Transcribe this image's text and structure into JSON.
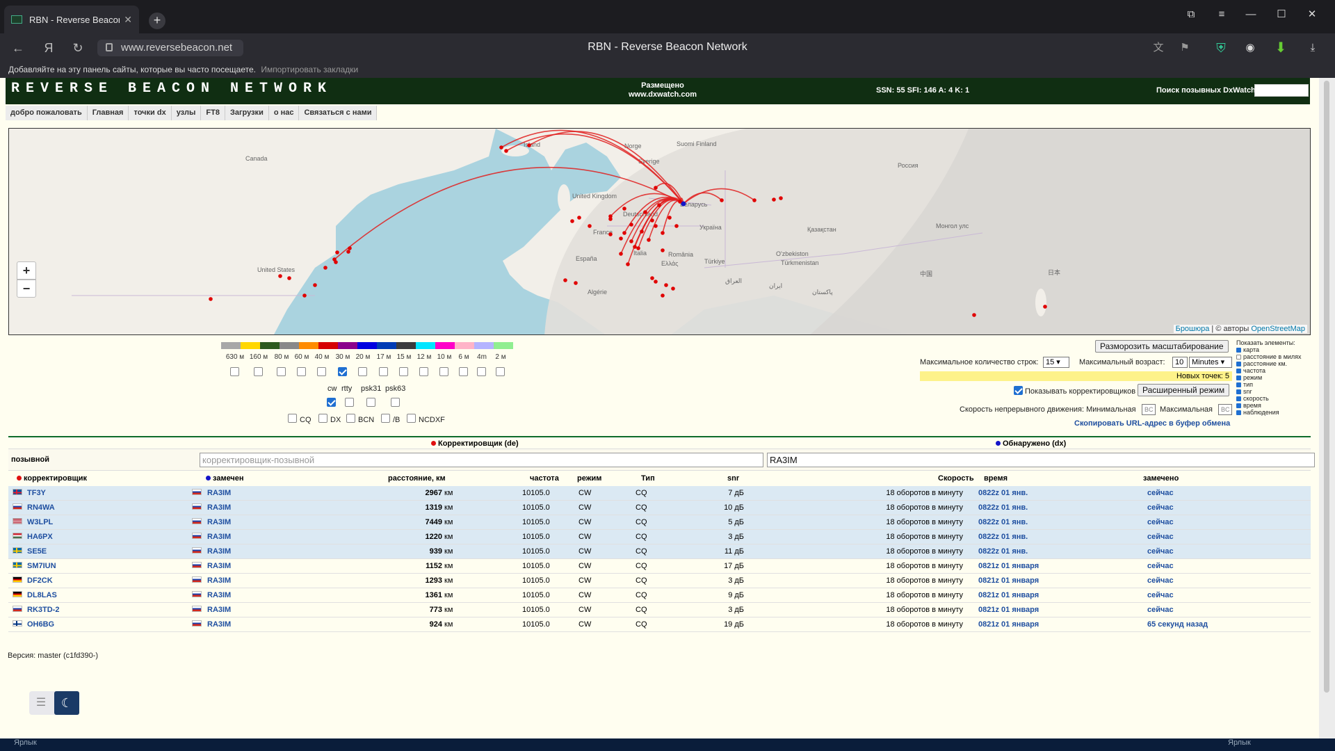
{
  "browser": {
    "tab_title": "RBN - Reverse Beacon N",
    "url": "www.reversebeacon.net",
    "window_title": "RBN - Reverse Beacon Network",
    "bookmarks_hint": "Добавляйте на эту панель сайты, которые вы часто посещаете.",
    "import_bookmarks": "Импортировать закладки"
  },
  "header": {
    "logo": "REVERSE BEACON NETWORK",
    "hosted_line1": "Размещено",
    "hosted_line2": "www.dxwatch.com",
    "solar": "SSN: 55 SFI: 146 A: 4 K: 1",
    "dxwatch_search_label": "Поиск позывных DxWatch:"
  },
  "menu": [
    "добро пожаловать",
    "Главная",
    "точки dx",
    "узлы",
    "FT8",
    "Загрузки",
    "о нас",
    "Связаться с нами"
  ],
  "map": {
    "labels": [
      "Island",
      "Norge",
      "Suomi Finland",
      "Sverige",
      "Canada",
      "Россия",
      "United Kingdom",
      "Deutschland",
      "Беларусь",
      "France",
      "Україна",
      "Қазақстан",
      "Монгол улс",
      "España",
      "Italia",
      "România",
      "O'zbekiston",
      "Türkmenistan",
      "United States",
      "Türkiye",
      "Ελλάς",
      "中国",
      "العراق",
      "ایران",
      "پاکستان",
      "Algérie",
      "日本"
    ],
    "attribution_browser": "Брошюра",
    "attribution_sep": "| © авторы",
    "attribution_osm": "OpenStreetMap",
    "zoom_in": "+",
    "zoom_out": "−"
  },
  "bands": {
    "colors": [
      "#a8a8a8",
      "#ffd700",
      "#2d5a1e",
      "#898989",
      "#ff8c00",
      "#d60000",
      "#8b008b",
      "#0000e0",
      "#003cb4",
      "#3c3c3c",
      "#00e6ff",
      "#ff00c8",
      "#ffb4c8",
      "#b4b4ff",
      "#90ee90"
    ],
    "labels": [
      "630 м",
      "160 м",
      "80 м",
      "60 м",
      "40 м",
      "30 м",
      "20 м",
      "17 м",
      "15 м",
      "12 м",
      "10 м",
      "6 м",
      "4m",
      "2 м"
    ],
    "checked": [
      false,
      false,
      false,
      false,
      false,
      true,
      false,
      false,
      false,
      false,
      false,
      false,
      false,
      false
    ]
  },
  "modes": {
    "labels": [
      "cw",
      "rtty",
      "psk31",
      "psk63"
    ],
    "checked": [
      true,
      false,
      false,
      false
    ]
  },
  "types": {
    "labels": [
      "CQ",
      "DX",
      "BCN",
      "/B",
      "NCDXF"
    ],
    "checked": [
      false,
      false,
      false,
      false,
      false
    ]
  },
  "controls": {
    "unfreeze_zoom": "Разморозить масштабирование",
    "max_rows_label": "Максимальное количество строк:",
    "max_rows_value": "15",
    "max_age_label": "Максимальный возраст:",
    "max_age_value": "10",
    "max_age_unit": "Minutes",
    "new_points": "Новых точек: 5",
    "show_skimmers": "Показывать корректировщиков",
    "show_skimmers_checked": true,
    "advanced_mode": "Расширенный режим",
    "scroll_speed": "Скорость непрерывного движения: Минимальная",
    "scroll_max": "Максимальная",
    "bc_min": "BC",
    "bc_max": "BC",
    "copy_url": "Скопировать URL-адрес в буфер обмена"
  },
  "show_elements": {
    "title": "Показать элементы:",
    "items": [
      {
        "label": "карта",
        "on": true
      },
      {
        "label": "расстояние в милях",
        "on": false
      },
      {
        "label": "расстояние км.",
        "on": true
      },
      {
        "label": "частота",
        "on": true
      },
      {
        "label": "режим",
        "on": true
      },
      {
        "label": "тип",
        "on": true
      },
      {
        "label": "snr",
        "on": true
      },
      {
        "label": "скорость",
        "on": true
      },
      {
        "label": "время",
        "on": true
      },
      {
        "label": "наблюдения",
        "on": true
      }
    ]
  },
  "table": {
    "spotter_header": "Корректировщик (de)",
    "spotted_header": "Обнаружено (dx)",
    "callsign_label": "позывной",
    "spotter_placeholder": "корректировщик-позывной",
    "spotted_value": "RA3IM",
    "columns": [
      "корректировщик",
      "замечен",
      "расстояние, км",
      "частота",
      "режим",
      "Тип",
      "snr",
      "Скорость",
      "время",
      "замечено"
    ],
    "rows": [
      {
        "de": "TF3Y",
        "de_flag": "IS",
        "dx": "RA3IM",
        "dist": "2967",
        "unit": "км",
        "freq": "10105.0",
        "mode": "CW",
        "type": "CQ",
        "snr": "7 дБ",
        "speed": "18 оборотов в минуту",
        "time": "0822z 01 янв.",
        "seen": "сейчас",
        "fresh": true
      },
      {
        "de": "RN4WA",
        "de_flag": "RU",
        "dx": "RA3IM",
        "dist": "1319",
        "unit": "км",
        "freq": "10105.0",
        "mode": "CW",
        "type": "CQ",
        "snr": "10 дБ",
        "speed": "18 оборотов в минуту",
        "time": "0822z 01 янв.",
        "seen": "сейчас",
        "fresh": true
      },
      {
        "de": "W3LPL",
        "de_flag": "US",
        "dx": "RA3IM",
        "dist": "7449",
        "unit": "км",
        "freq": "10105.0",
        "mode": "CW",
        "type": "CQ",
        "snr": "5 дБ",
        "speed": "18 оборотов в минуту",
        "time": "0822z 01 янв.",
        "seen": "сейчас",
        "fresh": true
      },
      {
        "de": "HA6PX",
        "de_flag": "HU",
        "dx": "RA3IM",
        "dist": "1220",
        "unit": "км",
        "freq": "10105.0",
        "mode": "CW",
        "type": "CQ",
        "snr": "3 дБ",
        "speed": "18 оборотов в минуту",
        "time": "0822z 01 янв.",
        "seen": "сейчас",
        "fresh": true
      },
      {
        "de": "SE5E",
        "de_flag": "SE",
        "dx": "RA3IM",
        "dist": "939",
        "unit": "км",
        "freq": "10105.0",
        "mode": "CW",
        "type": "CQ",
        "snr": "11 дБ",
        "speed": "18 оборотов в минуту",
        "time": "0822z 01 янв.",
        "seen": "сейчас",
        "fresh": true
      },
      {
        "de": "SM7IUN",
        "de_flag": "SE",
        "dx": "RA3IM",
        "dist": "1152",
        "unit": "км",
        "freq": "10105.0",
        "mode": "CW",
        "type": "CQ",
        "snr": "17 дБ",
        "speed": "18 оборотов в минуту",
        "time": "0821z 01 января",
        "seen": "сейчас",
        "fresh": false
      },
      {
        "de": "DF2CK",
        "de_flag": "DE",
        "dx": "RA3IM",
        "dist": "1293",
        "unit": "км",
        "freq": "10105.0",
        "mode": "CW",
        "type": "CQ",
        "snr": "3 дБ",
        "speed": "18 оборотов в минуту",
        "time": "0821z 01 января",
        "seen": "сейчас",
        "fresh": false
      },
      {
        "de": "DL8LAS",
        "de_flag": "DE",
        "dx": "RA3IM",
        "dist": "1361",
        "unit": "км",
        "freq": "10105.0",
        "mode": "CW",
        "type": "CQ",
        "snr": "9 дБ",
        "speed": "18 оборотов в минуту",
        "time": "0821z 01 января",
        "seen": "сейчас",
        "fresh": false
      },
      {
        "de": "RK3TD-2",
        "de_flag": "RU",
        "dx": "RA3IM",
        "dist": "773",
        "unit": "км",
        "freq": "10105.0",
        "mode": "CW",
        "type": "CQ",
        "snr": "3 дБ",
        "speed": "18 оборотов в минуту",
        "time": "0821z 01 января",
        "seen": "сейчас",
        "fresh": false
      },
      {
        "de": "OH6BG",
        "de_flag": "FI",
        "dx": "RA3IM",
        "dist": "924",
        "unit": "км",
        "freq": "10105.0",
        "mode": "CW",
        "type": "CQ",
        "snr": "19 дБ",
        "speed": "18 оборотов в минуту",
        "time": "0821z 01 января",
        "seen": "65 секунд назад",
        "fresh": false
      }
    ]
  },
  "version": "Версия: master (c1fd390-)",
  "taskbar_left": "Ярлык",
  "taskbar_right": "Ярлык"
}
